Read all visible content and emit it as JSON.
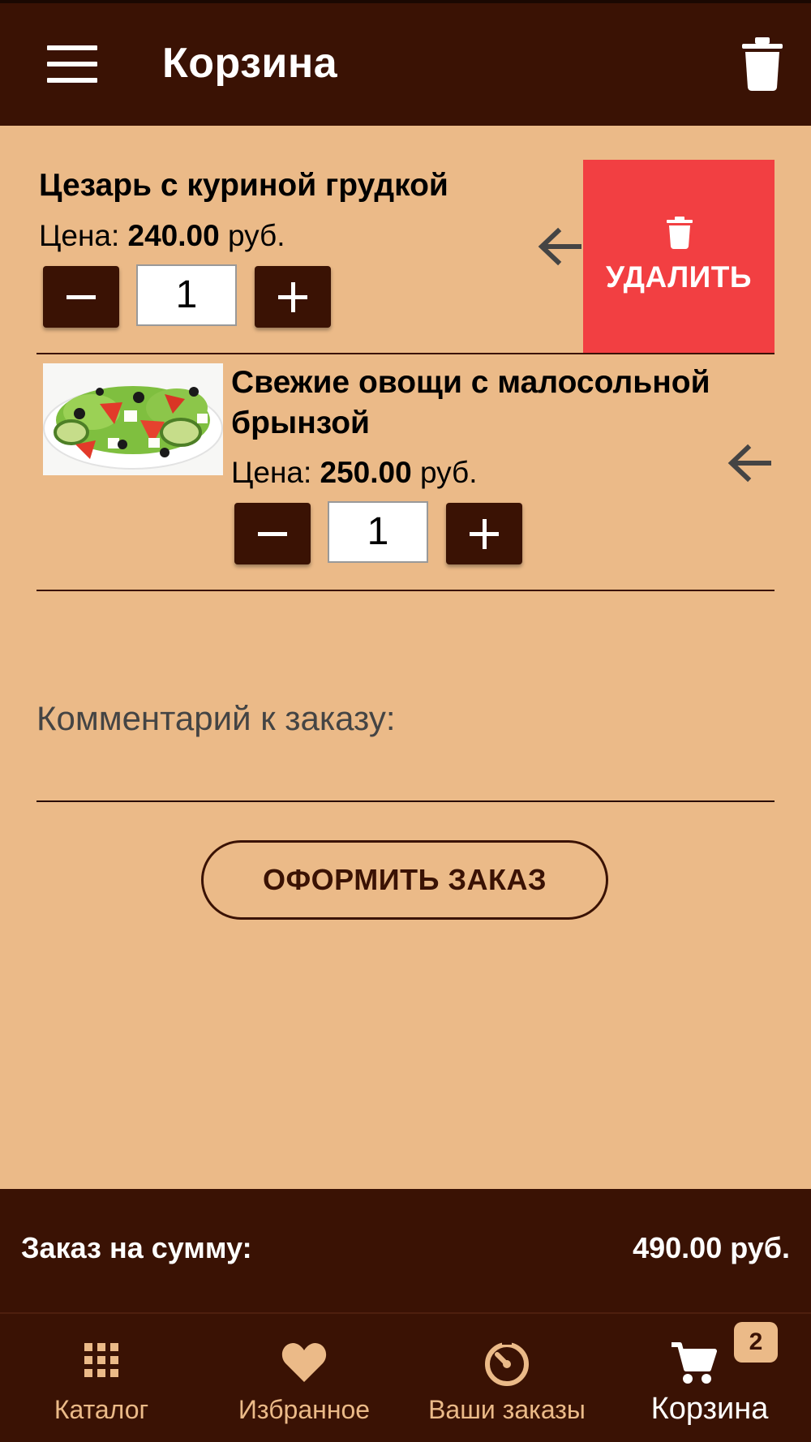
{
  "header": {
    "title": "Корзина"
  },
  "cart_items": [
    {
      "name": "Цезарь с куриной грудкой",
      "price_label": "Цена:",
      "price_value": "240.00",
      "currency": "руб.",
      "quantity": "1",
      "delete_label": "УДАЛИТЬ"
    },
    {
      "name_line1": "Свежие овощи с малосольной",
      "name_line2": "брынзой",
      "price_label": "Цена:",
      "price_value": "250.00",
      "currency": "руб.",
      "quantity": "1"
    }
  ],
  "comment": {
    "label": "Комментарий к заказу:"
  },
  "order_button": {
    "label": "ОФОРМИТЬ ЗАКАЗ"
  },
  "total": {
    "label": "Заказ на сумму:",
    "value": "490.00 руб."
  },
  "bottom_nav": {
    "items": [
      {
        "label": "Каталог",
        "icon": "grid-icon"
      },
      {
        "label": "Избранное",
        "icon": "heart-icon"
      },
      {
        "label": "Ваши заказы",
        "icon": "timer-icon"
      },
      {
        "label": "Корзина",
        "icon": "cart-icon"
      }
    ],
    "cart_badge": "2"
  },
  "colors": {
    "primary": "#3A1204",
    "background": "#EBBA88",
    "delete": "#F23F42"
  }
}
